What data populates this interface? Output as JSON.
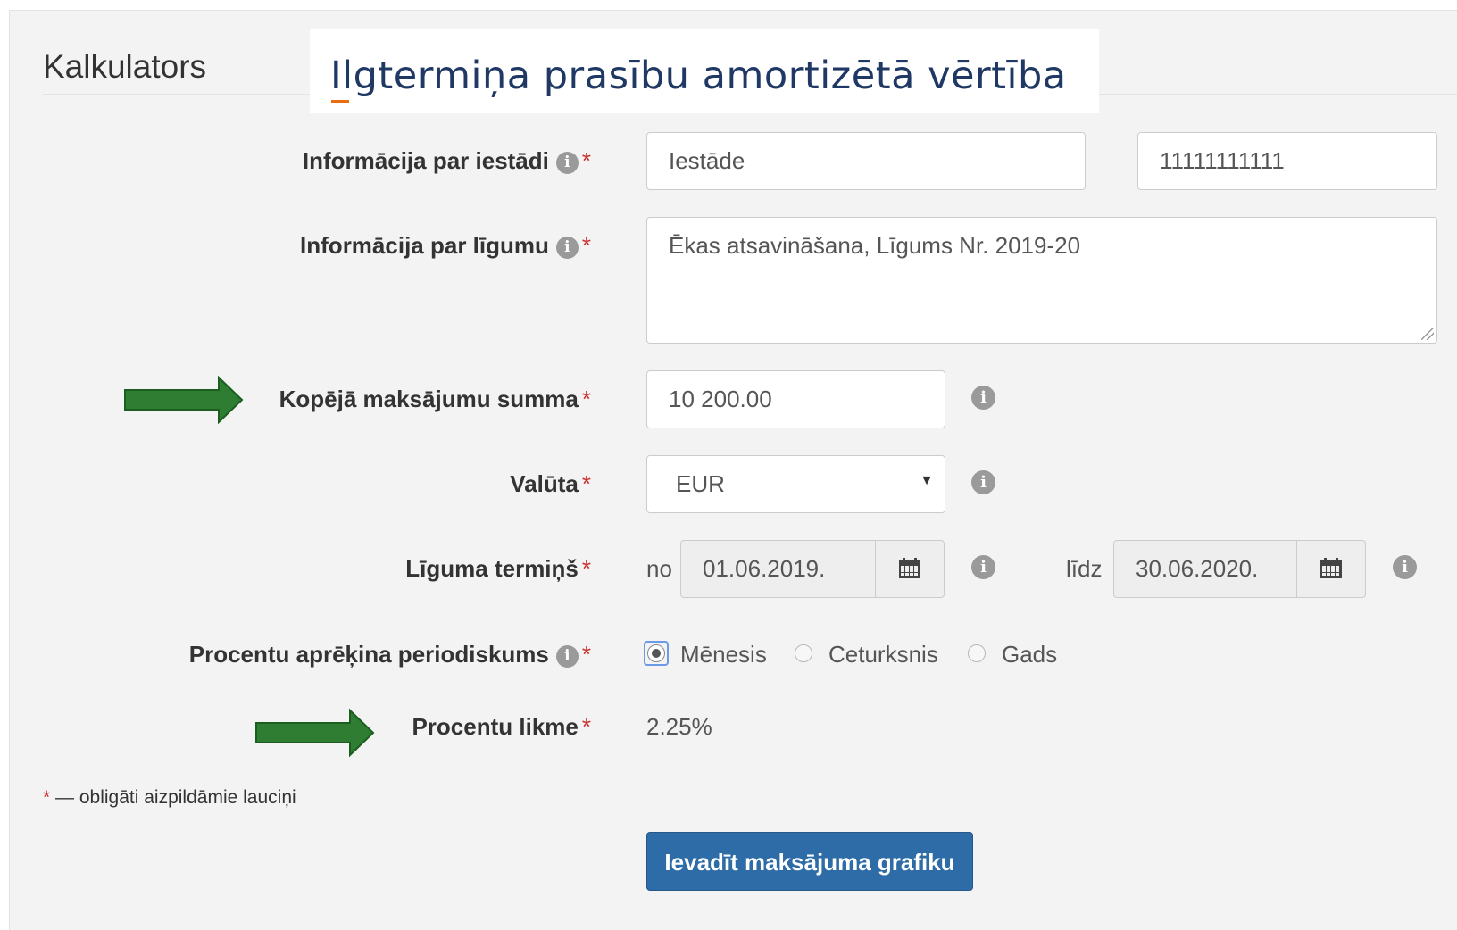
{
  "header": {
    "app_title": "Kalkulators",
    "page_title": "Ilgtermiņa prasību amortizētā vērtība"
  },
  "form": {
    "institution": {
      "label": "Informācija par iestādi",
      "name_value": "Iestāde",
      "code_value": "11111111111"
    },
    "contract": {
      "label": "Informācija par līgumu",
      "value": "Ēkas atsavināšana, Līgums Nr. 2019-20"
    },
    "total_amount": {
      "label": "Kopējā maksājumu summa",
      "value": "10 200.00"
    },
    "currency": {
      "label": "Valūta",
      "selected": "EUR"
    },
    "term": {
      "label": "Līguma termiņš",
      "from_label": "no",
      "from_value": "01.06.2019.",
      "to_label": "līdz",
      "to_value": "30.06.2020."
    },
    "periodicity": {
      "label": "Procentu aprēķina periodiskums",
      "options": [
        "Mēnesis",
        "Ceturksnis",
        "Gads"
      ],
      "selected": "Mēnesis"
    },
    "interest_rate": {
      "label": "Procentu likme",
      "value": "2.25%"
    },
    "required_mark": "*",
    "info_glyph": "i"
  },
  "footnote": {
    "star": "*",
    "text": " — obligāti aizpildāmie lauciņi"
  },
  "submit_button": {
    "label": "Ievadīt maksājuma grafiku"
  },
  "colors": {
    "annotation_arrow": "#2e7d32",
    "primary_button": "#2d6ca6",
    "required_star": "#c9302c"
  }
}
